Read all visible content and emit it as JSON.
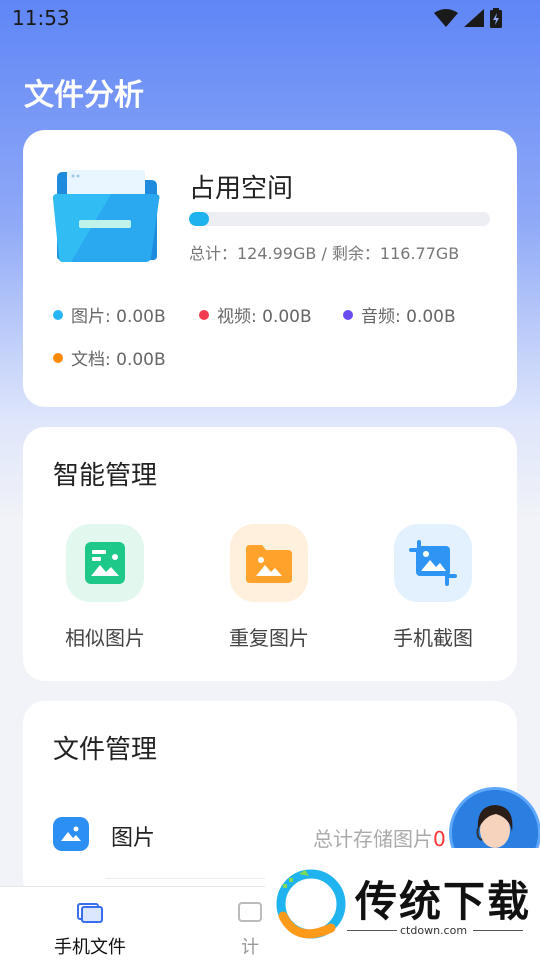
{
  "status": {
    "time": "11:53"
  },
  "page": {
    "title": "文件分析"
  },
  "storage": {
    "title": "占用空间",
    "used_fraction": 0.066,
    "summary": "总计：124.99GB / 剩余：116.77GB",
    "legend": [
      {
        "label": "图片: 0.00B",
        "color": "#29b6f6"
      },
      {
        "label": "视频: 0.00B",
        "color": "#f23c4f"
      },
      {
        "label": "音频: 0.00B",
        "color": "#6a4cf0"
      },
      {
        "label": "文档: 0.00B",
        "color": "#ff8a00"
      }
    ]
  },
  "smart": {
    "title": "智能管理",
    "tools": [
      {
        "label": "相似图片",
        "icon": "similar-image-icon",
        "bg": "#e2f8ee",
        "fg": "#1ec889"
      },
      {
        "label": "重复图片",
        "icon": "duplicate-image-icon",
        "bg": "#fff0de",
        "fg": "#ffa22c"
      },
      {
        "label": "手机截图",
        "icon": "screenshot-icon",
        "bg": "#e3f1ff",
        "fg": "#2f95f5"
      }
    ]
  },
  "files": {
    "title": "文件管理",
    "rows": [
      {
        "label": "图片",
        "value_prefix": "总计存储图片",
        "value_highlight": "0"
      }
    ]
  },
  "nav": {
    "items": [
      {
        "label": "手机文件",
        "active": true
      },
      {
        "label": "计",
        "active": false
      }
    ]
  },
  "watermark": {
    "text": "传统下载",
    "url": "ctdown.com"
  }
}
